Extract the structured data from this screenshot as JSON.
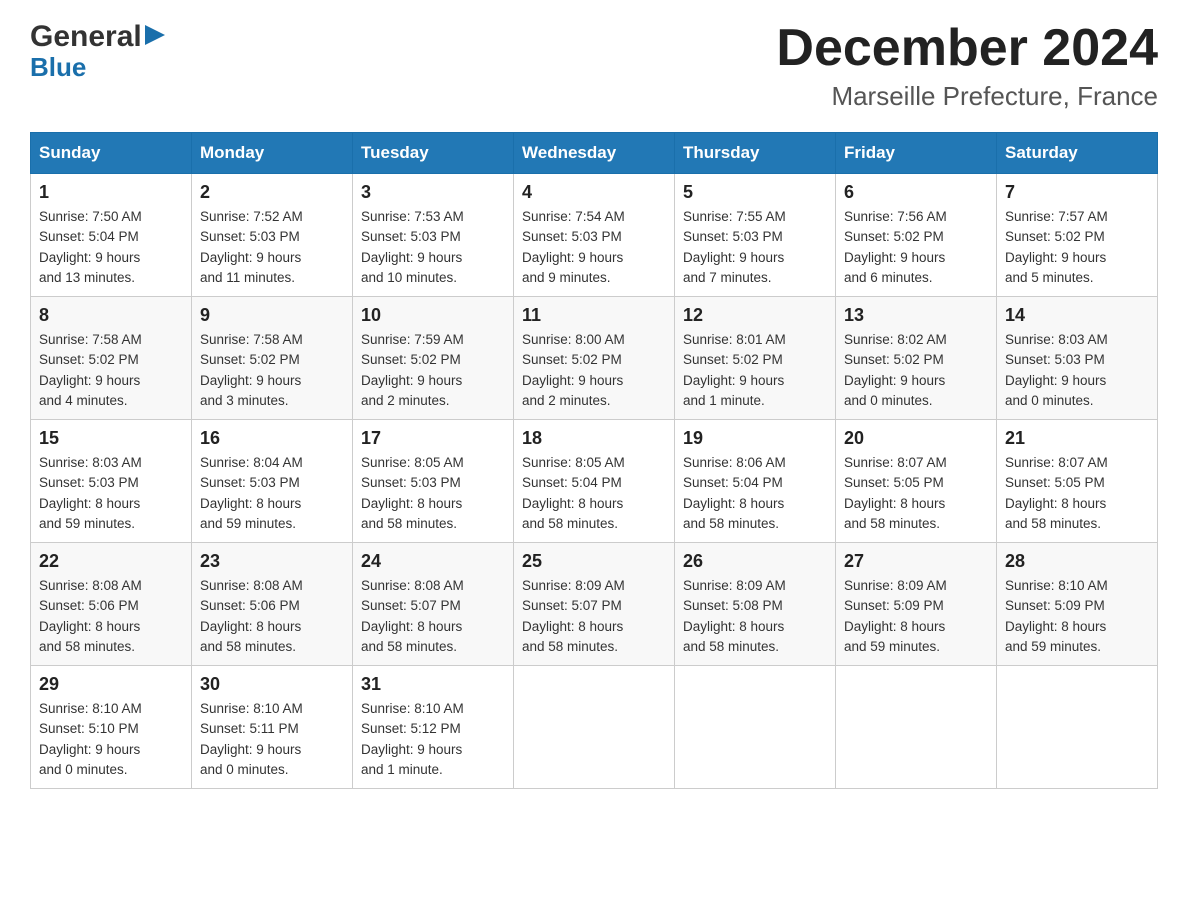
{
  "header": {
    "logo_general": "General",
    "logo_blue": "Blue",
    "month_title": "December 2024",
    "subtitle": "Marseille Prefecture, France"
  },
  "days_header": [
    "Sunday",
    "Monday",
    "Tuesday",
    "Wednesday",
    "Thursday",
    "Friday",
    "Saturday"
  ],
  "weeks": [
    [
      {
        "num": "1",
        "sunrise": "7:50 AM",
        "sunset": "5:04 PM",
        "daylight": "9 hours and 13 minutes."
      },
      {
        "num": "2",
        "sunrise": "7:52 AM",
        "sunset": "5:03 PM",
        "daylight": "9 hours and 11 minutes."
      },
      {
        "num": "3",
        "sunrise": "7:53 AM",
        "sunset": "5:03 PM",
        "daylight": "9 hours and 10 minutes."
      },
      {
        "num": "4",
        "sunrise": "7:54 AM",
        "sunset": "5:03 PM",
        "daylight": "9 hours and 9 minutes."
      },
      {
        "num": "5",
        "sunrise": "7:55 AM",
        "sunset": "5:03 PM",
        "daylight": "9 hours and 7 minutes."
      },
      {
        "num": "6",
        "sunrise": "7:56 AM",
        "sunset": "5:02 PM",
        "daylight": "9 hours and 6 minutes."
      },
      {
        "num": "7",
        "sunrise": "7:57 AM",
        "sunset": "5:02 PM",
        "daylight": "9 hours and 5 minutes."
      }
    ],
    [
      {
        "num": "8",
        "sunrise": "7:58 AM",
        "sunset": "5:02 PM",
        "daylight": "9 hours and 4 minutes."
      },
      {
        "num": "9",
        "sunrise": "7:58 AM",
        "sunset": "5:02 PM",
        "daylight": "9 hours and 3 minutes."
      },
      {
        "num": "10",
        "sunrise": "7:59 AM",
        "sunset": "5:02 PM",
        "daylight": "9 hours and 2 minutes."
      },
      {
        "num": "11",
        "sunrise": "8:00 AM",
        "sunset": "5:02 PM",
        "daylight": "9 hours and 2 minutes."
      },
      {
        "num": "12",
        "sunrise": "8:01 AM",
        "sunset": "5:02 PM",
        "daylight": "9 hours and 1 minute."
      },
      {
        "num": "13",
        "sunrise": "8:02 AM",
        "sunset": "5:02 PM",
        "daylight": "9 hours and 0 minutes."
      },
      {
        "num": "14",
        "sunrise": "8:03 AM",
        "sunset": "5:03 PM",
        "daylight": "9 hours and 0 minutes."
      }
    ],
    [
      {
        "num": "15",
        "sunrise": "8:03 AM",
        "sunset": "5:03 PM",
        "daylight": "8 hours and 59 minutes."
      },
      {
        "num": "16",
        "sunrise": "8:04 AM",
        "sunset": "5:03 PM",
        "daylight": "8 hours and 59 minutes."
      },
      {
        "num": "17",
        "sunrise": "8:05 AM",
        "sunset": "5:03 PM",
        "daylight": "8 hours and 58 minutes."
      },
      {
        "num": "18",
        "sunrise": "8:05 AM",
        "sunset": "5:04 PM",
        "daylight": "8 hours and 58 minutes."
      },
      {
        "num": "19",
        "sunrise": "8:06 AM",
        "sunset": "5:04 PM",
        "daylight": "8 hours and 58 minutes."
      },
      {
        "num": "20",
        "sunrise": "8:07 AM",
        "sunset": "5:05 PM",
        "daylight": "8 hours and 58 minutes."
      },
      {
        "num": "21",
        "sunrise": "8:07 AM",
        "sunset": "5:05 PM",
        "daylight": "8 hours and 58 minutes."
      }
    ],
    [
      {
        "num": "22",
        "sunrise": "8:08 AM",
        "sunset": "5:06 PM",
        "daylight": "8 hours and 58 minutes."
      },
      {
        "num": "23",
        "sunrise": "8:08 AM",
        "sunset": "5:06 PM",
        "daylight": "8 hours and 58 minutes."
      },
      {
        "num": "24",
        "sunrise": "8:08 AM",
        "sunset": "5:07 PM",
        "daylight": "8 hours and 58 minutes."
      },
      {
        "num": "25",
        "sunrise": "8:09 AM",
        "sunset": "5:07 PM",
        "daylight": "8 hours and 58 minutes."
      },
      {
        "num": "26",
        "sunrise": "8:09 AM",
        "sunset": "5:08 PM",
        "daylight": "8 hours and 58 minutes."
      },
      {
        "num": "27",
        "sunrise": "8:09 AM",
        "sunset": "5:09 PM",
        "daylight": "8 hours and 59 minutes."
      },
      {
        "num": "28",
        "sunrise": "8:10 AM",
        "sunset": "5:09 PM",
        "daylight": "8 hours and 59 minutes."
      }
    ],
    [
      {
        "num": "29",
        "sunrise": "8:10 AM",
        "sunset": "5:10 PM",
        "daylight": "9 hours and 0 minutes."
      },
      {
        "num": "30",
        "sunrise": "8:10 AM",
        "sunset": "5:11 PM",
        "daylight": "9 hours and 0 minutes."
      },
      {
        "num": "31",
        "sunrise": "8:10 AM",
        "sunset": "5:12 PM",
        "daylight": "9 hours and 1 minute."
      },
      null,
      null,
      null,
      null
    ]
  ],
  "labels": {
    "sunrise": "Sunrise:",
    "sunset": "Sunset:",
    "daylight": "Daylight:"
  }
}
